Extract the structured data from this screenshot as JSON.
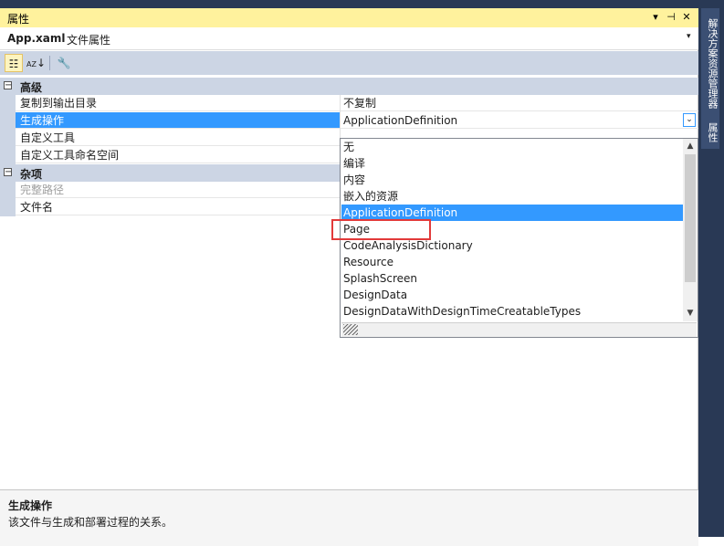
{
  "window": {
    "title": "属性",
    "buttons": {
      "menu": "▾",
      "pin": "⊣",
      "close": "✕"
    }
  },
  "side_tabs": [
    "解决方案资源管理器",
    "属性"
  ],
  "object_bar": {
    "name": "App.xaml",
    "type": "文件属性",
    "dropdown_glyph": "▾"
  },
  "toolbar": {
    "categorized_glyph": "☷",
    "alphabetical_glyph": "↓",
    "property_pages_glyph": "🔧"
  },
  "grid": {
    "category_advanced": {
      "toggle": "−",
      "label": "高级"
    },
    "rows_advanced": [
      {
        "name": "复制到输出目录",
        "value": "不复制"
      },
      {
        "name": "生成操作",
        "value": "ApplicationDefinition"
      },
      {
        "name": "自定义工具",
        "value": ""
      },
      {
        "name": "自定义工具命名空间",
        "value": ""
      }
    ],
    "category_misc": {
      "toggle": "−",
      "label": "杂项"
    },
    "rows_misc": [
      {
        "name": "完整路径",
        "value": ""
      },
      {
        "name": "文件名",
        "value": ""
      }
    ]
  },
  "dropdown": {
    "options": [
      "无",
      "编译",
      "内容",
      "嵌入的资源",
      "ApplicationDefinition",
      "Page",
      "CodeAnalysisDictionary",
      "Resource",
      "SplashScreen",
      "DesignData",
      "DesignDataWithDesignTimeCreatableTypes"
    ],
    "selected": "ApplicationDefinition",
    "scroll_up": "▲",
    "scroll_down": "▼"
  },
  "description": {
    "title": "生成操作",
    "text": "该文件与生成和部署过程的关系。"
  },
  "colors": {
    "title_bar": "#fff29d",
    "selection": "#3399ff",
    "frame": "#293955",
    "category_band": "#ccd5e4",
    "highlight": "#e23a3a"
  }
}
